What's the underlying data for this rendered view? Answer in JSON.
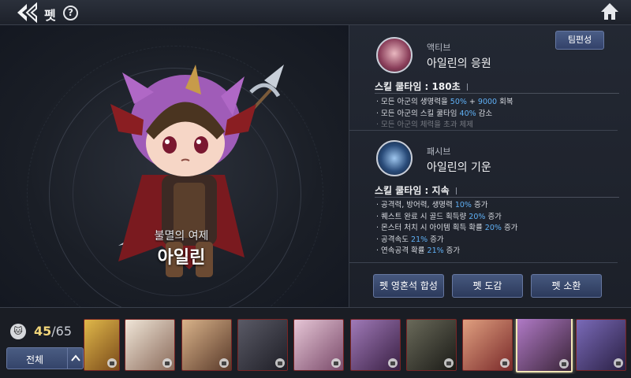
{
  "header": {
    "title": "펫",
    "help_label": "?"
  },
  "pet": {
    "epithet": "불멸의 여제",
    "name": "아일린"
  },
  "panel": {
    "team_button": "팀편성",
    "active_skill": {
      "type": "액티브",
      "name": "아일린의 응원",
      "cooldown_label": "스킬 쿨타임 :",
      "cooldown_value": "180초",
      "effects": [
        {
          "pre": "모든 아군의 생명력을 ",
          "hl1": "50%",
          "mid": " + ",
          "hl2": "9000",
          "post": " 회복"
        },
        {
          "pre": "모든 아군의 스킬 쿨타임 ",
          "hl1": "40%",
          "mid": "",
          "hl2": "",
          "post": " 감소"
        },
        {
          "pre": "모든 아군의 체력을 초과 체제",
          "hl1": "",
          "mid": "",
          "hl2": "",
          "post": ""
        }
      ]
    },
    "passive_skill": {
      "type": "패시브",
      "name": "아일린의 기운",
      "cooldown_label": "스킬 쿨타임 :",
      "cooldown_value": "지속",
      "effects": [
        {
          "pre": "공격력, 방어력, 생명력 ",
          "hl": "10%",
          "post": " 증가"
        },
        {
          "pre": "퀘스트 완료 시 골드 획득량 ",
          "hl": "20%",
          "post": " 증가"
        },
        {
          "pre": "몬스터 처치 시 아이템 획득 확률 ",
          "hl": "20%",
          "post": " 증가"
        },
        {
          "pre": "공격속도 ",
          "hl": "21%",
          "post": " 증가"
        },
        {
          "pre": "연속공격 확률 ",
          "hl": "21%",
          "post": " 증가"
        }
      ]
    },
    "actions": {
      "synth": "펫 영혼석 합성",
      "codex": "펫 도감",
      "summon": "펫 소환"
    }
  },
  "bottom": {
    "count_current": "45",
    "count_sep": "/",
    "count_max": "65",
    "filter_label": "전체"
  },
  "colors": {
    "accent_blue": "#5fb0f5",
    "count_gold": "#f1d57a",
    "slot_border": "#7a2424",
    "selected_border": "#f3e7b6"
  }
}
